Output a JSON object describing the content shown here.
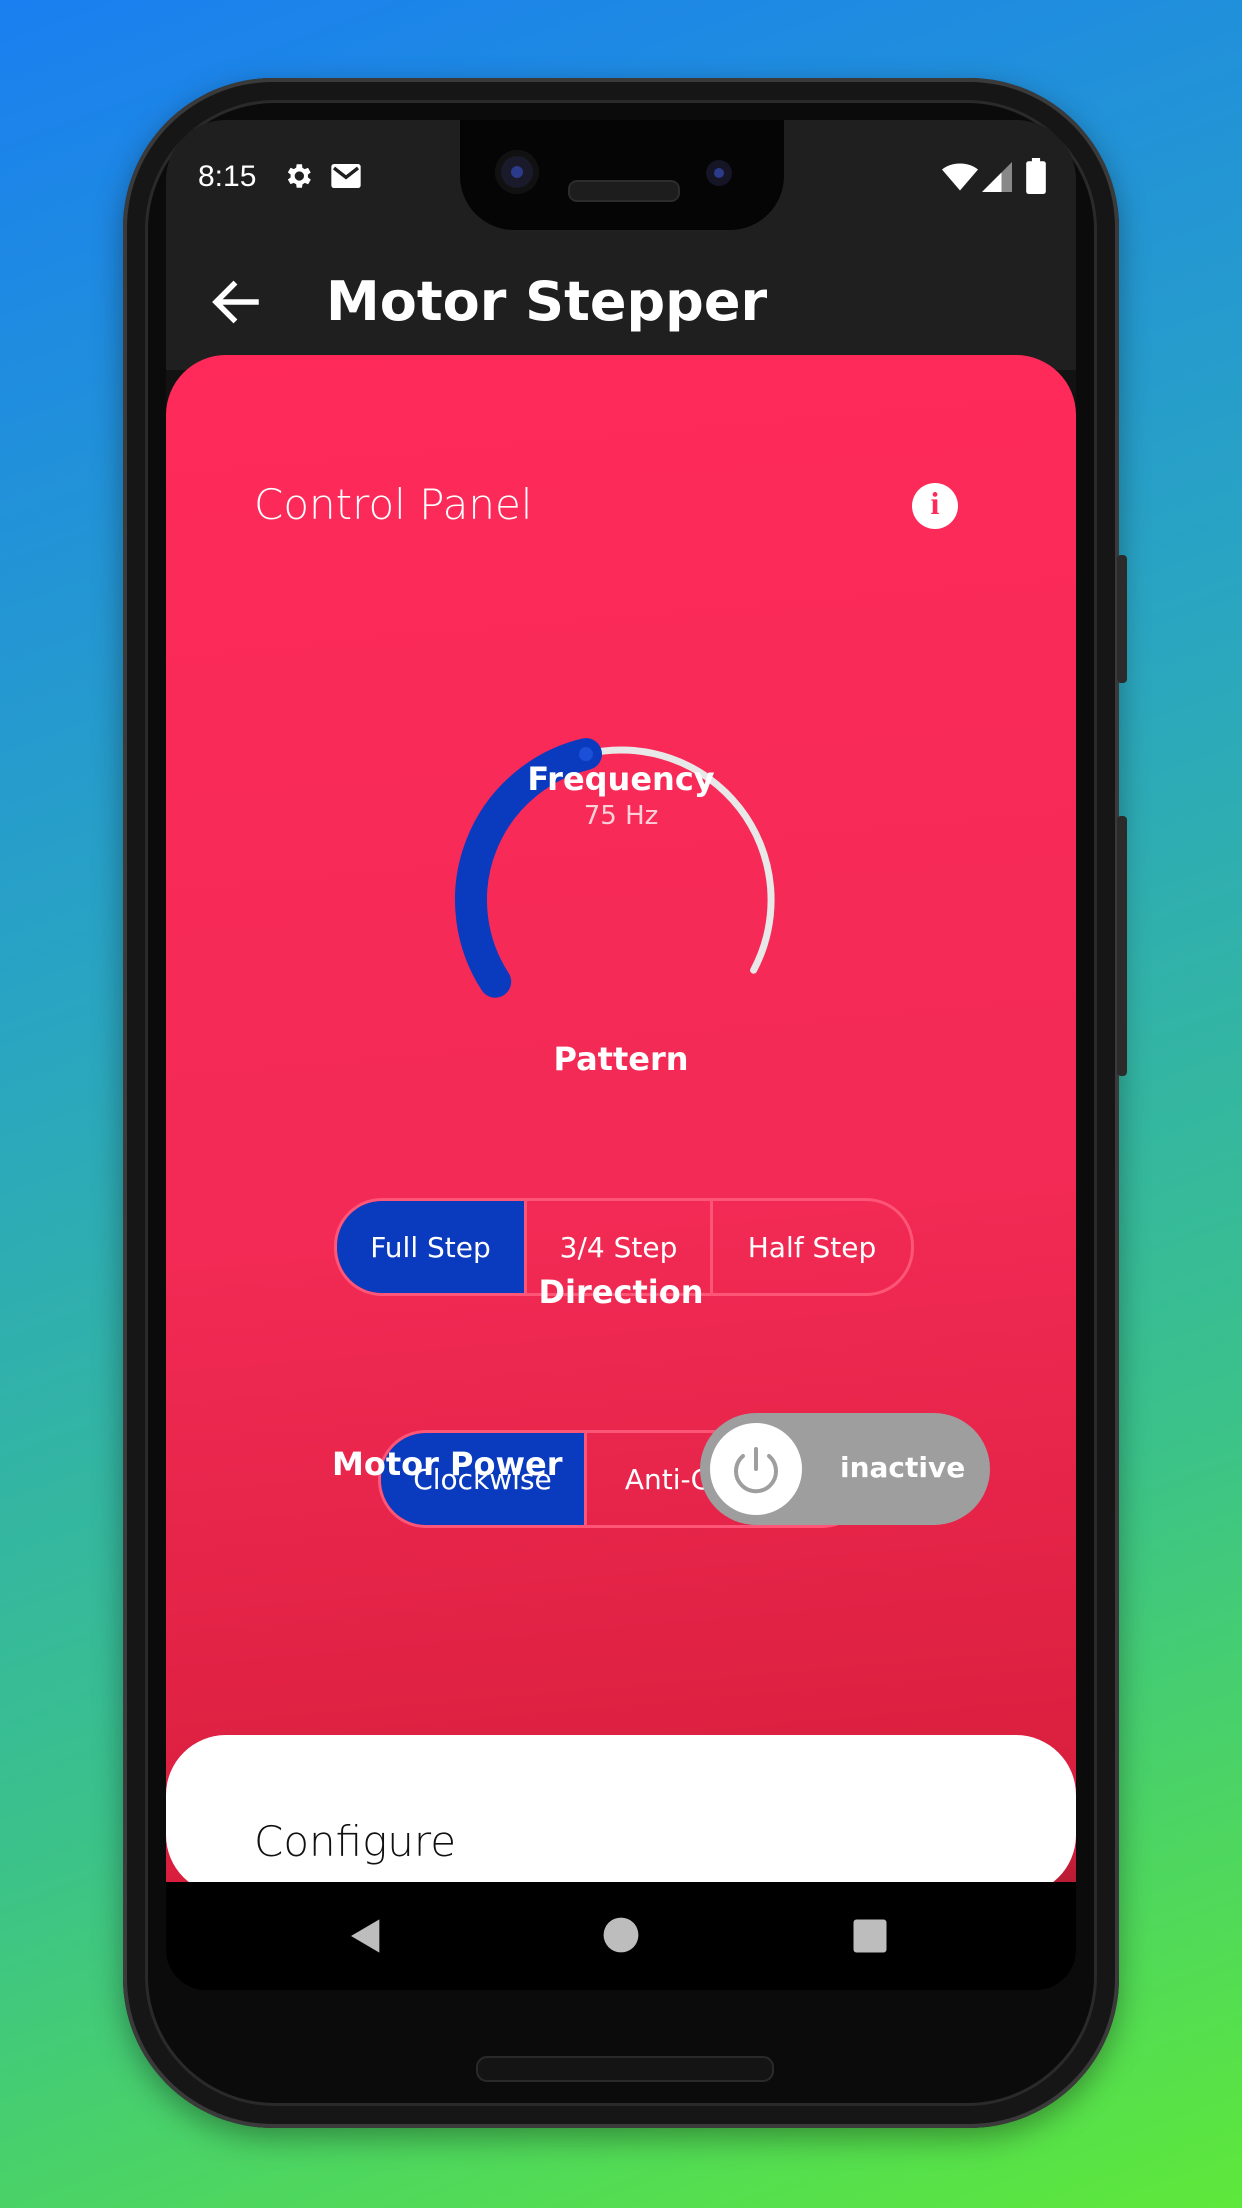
{
  "status_bar": {
    "time": "8:15",
    "icons": [
      "settings-icon",
      "gmail-icon",
      "wifi-icon",
      "signal-icon",
      "battery-icon"
    ]
  },
  "app_bar": {
    "title": "Motor Stepper",
    "back_icon": "arrow-left-icon"
  },
  "control_panel": {
    "title": "Control Panel",
    "info_icon": "info-icon",
    "info_glyph": "i",
    "frequency": {
      "label": "Frequency",
      "value_text": "75 Hz",
      "value": 75,
      "fraction": 0.45
    },
    "pattern": {
      "label": "Pattern",
      "options": [
        "Full Step",
        "3/4 Step",
        "Half Step"
      ],
      "selected": "Full Step"
    },
    "direction": {
      "label": "Direction",
      "options": [
        "Clockwise",
        "Anti-Clockwise"
      ],
      "selected": "Clockwise"
    },
    "motor_power": {
      "label": "Motor Power",
      "state": "inactive",
      "icon": "power-icon"
    }
  },
  "bottom_sheet": {
    "title": "Configure"
  },
  "colors": {
    "accent_blue": "#0a3bbf",
    "card_red": "#ff2a5a",
    "toggle_grey": "#9e9e9e"
  },
  "nav_bar": {
    "icons": [
      "back-triangle-icon",
      "home-circle-icon",
      "recents-square-icon"
    ]
  }
}
